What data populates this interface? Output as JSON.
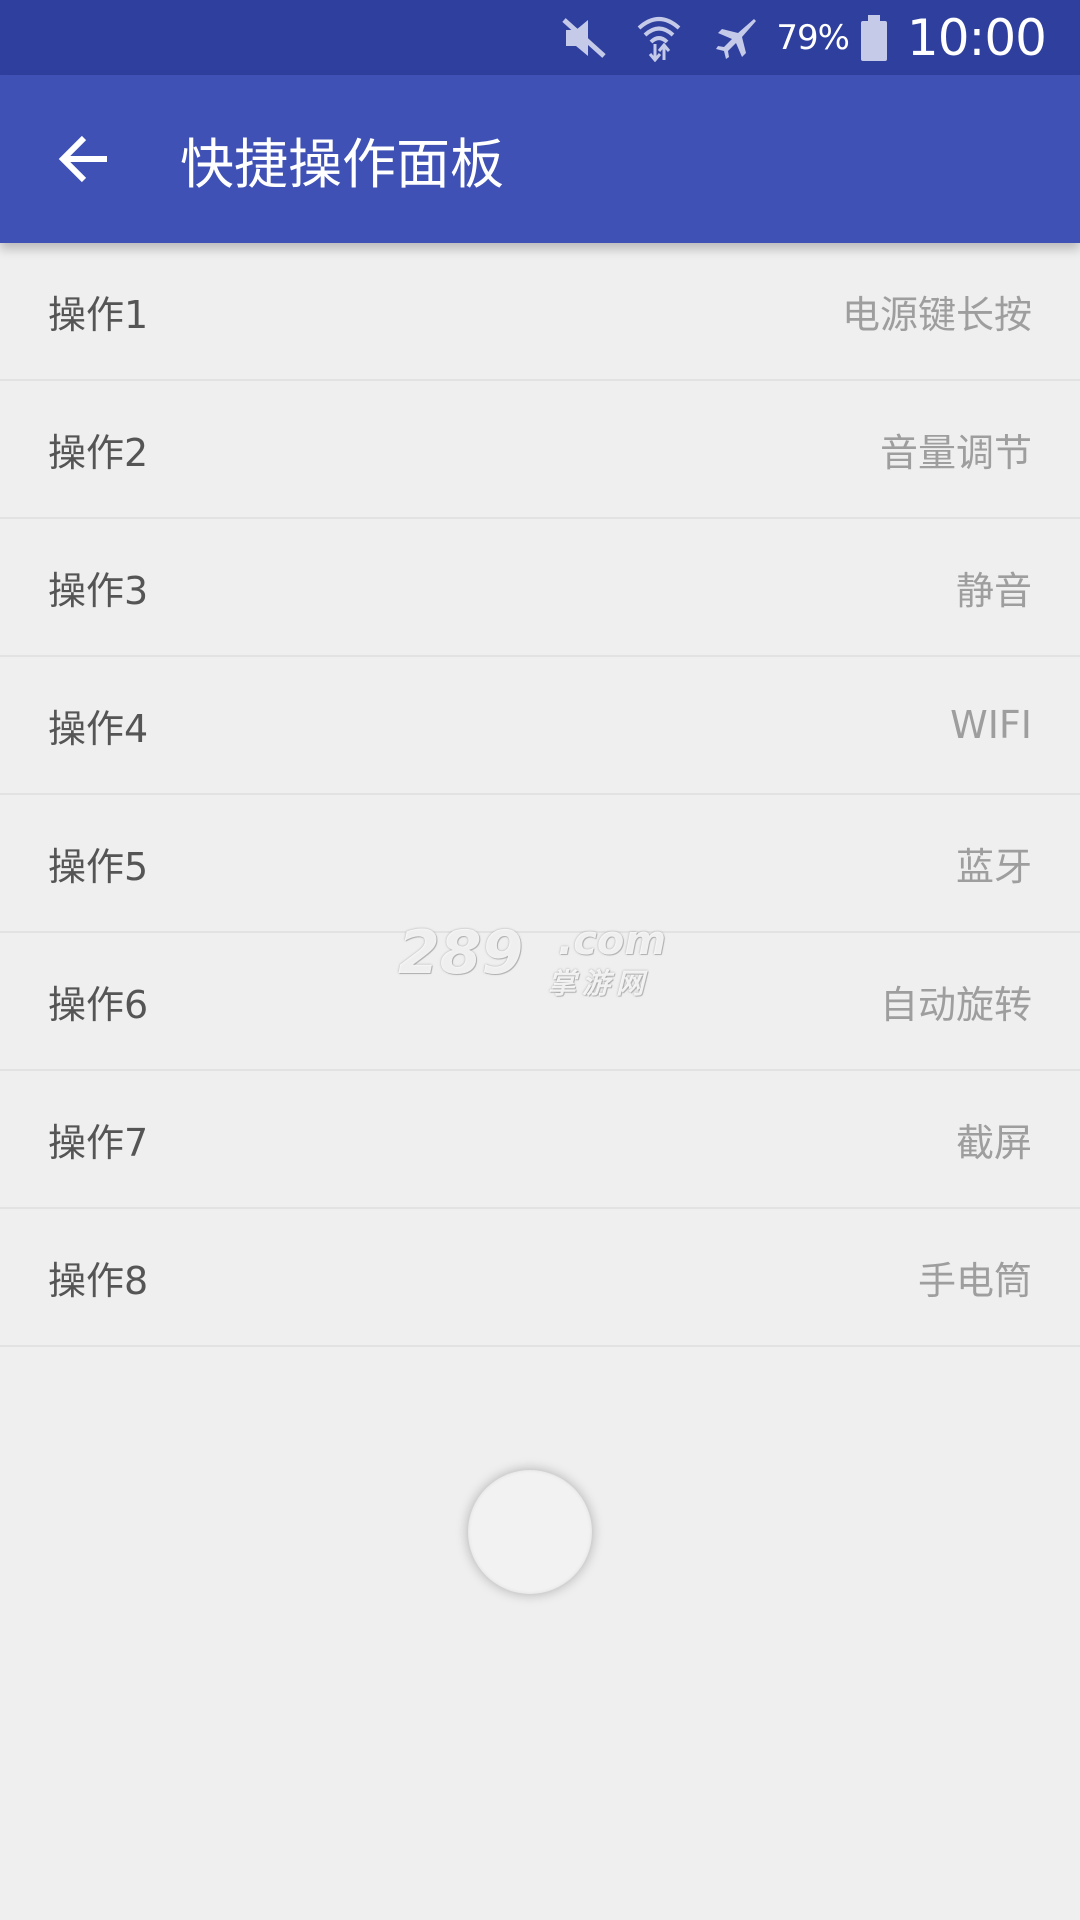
{
  "status_bar": {
    "battery_percent": "79%",
    "time": "10:00",
    "icons": [
      "mute-icon",
      "wifi-icon",
      "airplane-mode-icon",
      "battery-icon"
    ]
  },
  "app_bar": {
    "title": "快捷操作面板",
    "back_icon": "arrow-back-icon"
  },
  "actions": [
    {
      "label": "操作1",
      "value": "电源键长按"
    },
    {
      "label": "操作2",
      "value": "音量调节"
    },
    {
      "label": "操作3",
      "value": "静音"
    },
    {
      "label": "操作4",
      "value": "WIFI"
    },
    {
      "label": "操作5",
      "value": "蓝牙"
    },
    {
      "label": "操作6",
      "value": "自动旋转"
    },
    {
      "label": "操作7",
      "value": "截屏"
    },
    {
      "label": "操作8",
      "value": "手电筒"
    }
  ],
  "watermark": {
    "number": "289",
    "domain": ".com",
    "site": "掌游网"
  },
  "colors": {
    "status_bar": "#2f3f9e",
    "app_bar": "#3f51b5",
    "background": "#efefef",
    "label_text": "#555555",
    "value_text": "#9e9e9e"
  }
}
